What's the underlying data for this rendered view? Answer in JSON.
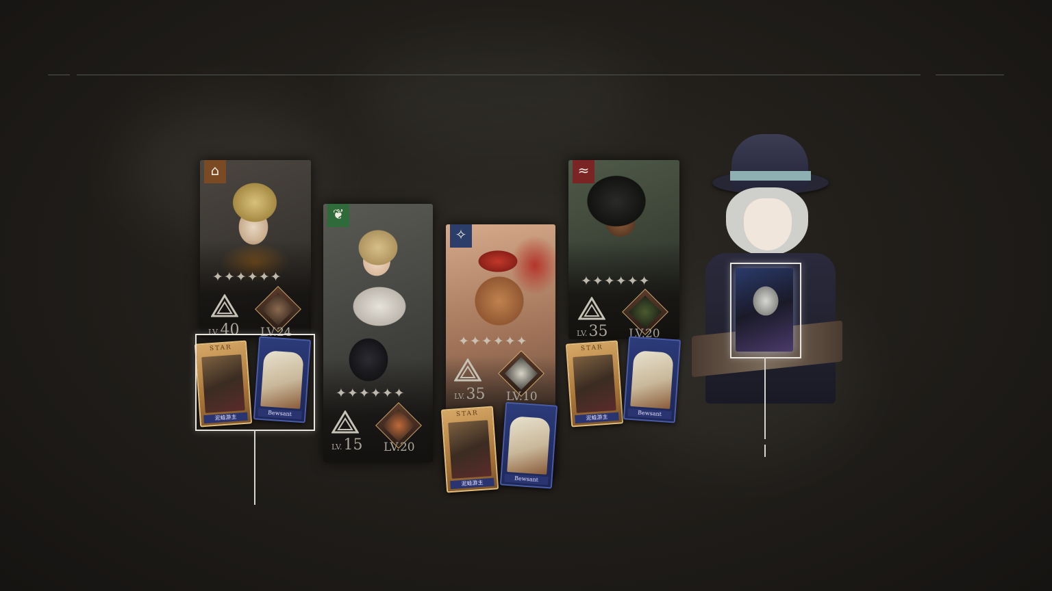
{
  "cards": [
    {
      "id": "card-1",
      "attr_icon": "gold-building-icon",
      "attr_color": "#7a4a24",
      "level": "40",
      "sub_level": "LV.24",
      "lv_prefix": "LV.",
      "stars": 6
    },
    {
      "id": "card-2",
      "attr_icon": "green-leaf-icon",
      "attr_color": "#2f6a3a",
      "level": "15",
      "sub_level": "LV.20",
      "lv_prefix": "LV.",
      "stars": 6
    },
    {
      "id": "card-3",
      "attr_icon": "blue-star-icon",
      "attr_color": "#2b3e6a",
      "level": "35",
      "sub_level": "LV.10",
      "lv_prefix": "LV.",
      "stars": 6
    },
    {
      "id": "card-4",
      "attr_icon": "red-wing-icon",
      "attr_color": "#7a2424",
      "level": "35",
      "sub_level": "LV.20",
      "lv_prefix": "LV.",
      "stars": 6
    }
  ],
  "mini_cards": {
    "gold_label": "STAR",
    "gold_signature": "泥蛙游主",
    "blue_signature": "Bewsant"
  },
  "colors": {
    "accent_line": "#d9d6cf",
    "top_line": "#4f5650"
  }
}
